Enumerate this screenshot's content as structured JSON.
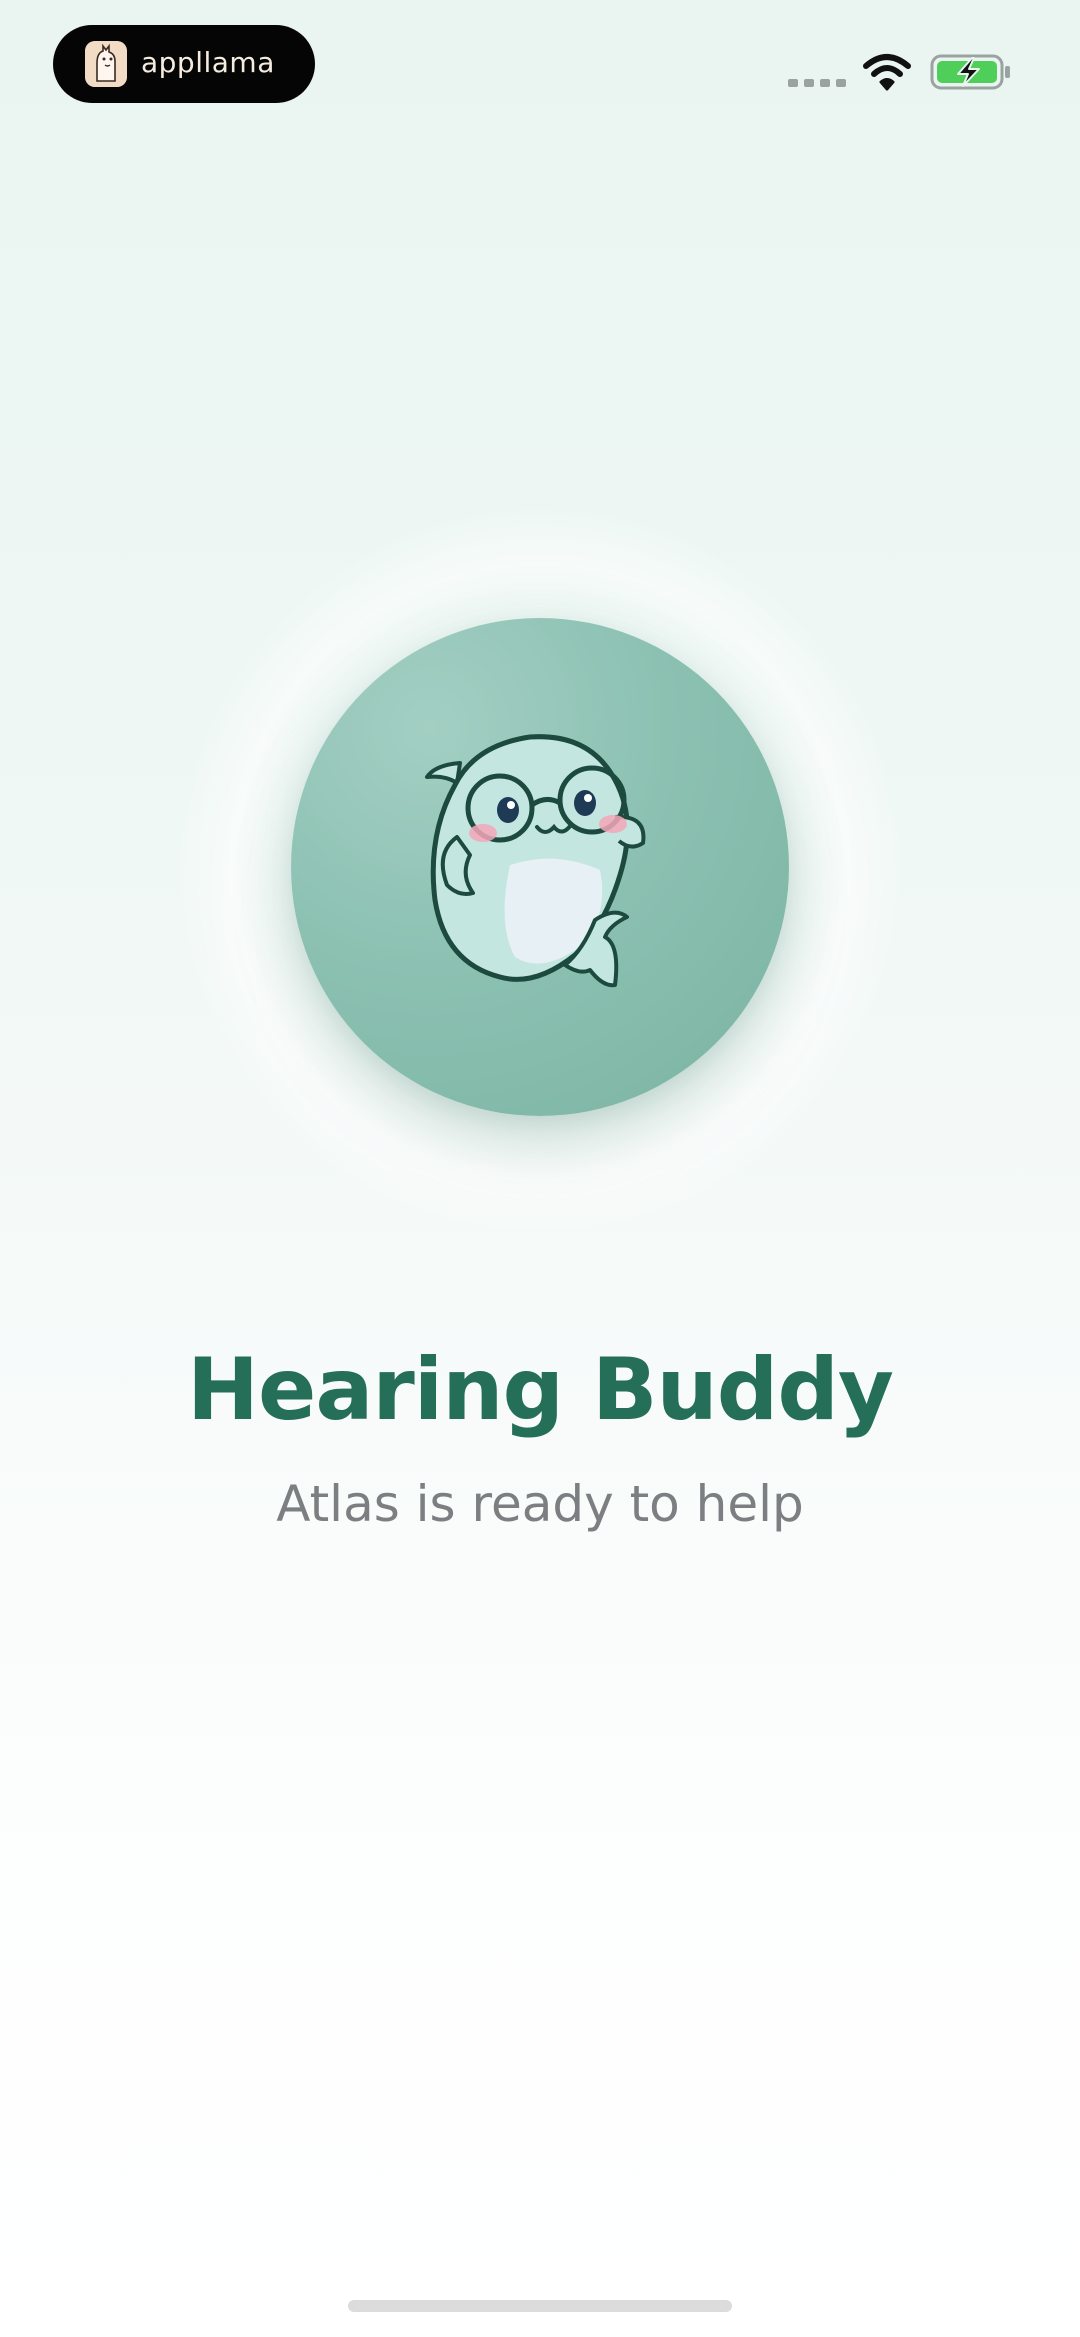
{
  "status_bar": {
    "app_name": "appllama",
    "icons": [
      "llama-logo-icon",
      "signal-icon",
      "wifi-icon",
      "battery-charging-icon"
    ],
    "battery_color": "#4fcf5a"
  },
  "hero": {
    "mascot_icon": "dolphin-with-glasses-icon",
    "circle_color": "#86bba9"
  },
  "title": "Hearing Buddy",
  "subtitle": "Atlas is ready to help",
  "colors": {
    "title": "#256f58",
    "subtitle": "#7b7f82",
    "background_top": "#eaf5f1",
    "background_bottom": "#ffffff"
  }
}
